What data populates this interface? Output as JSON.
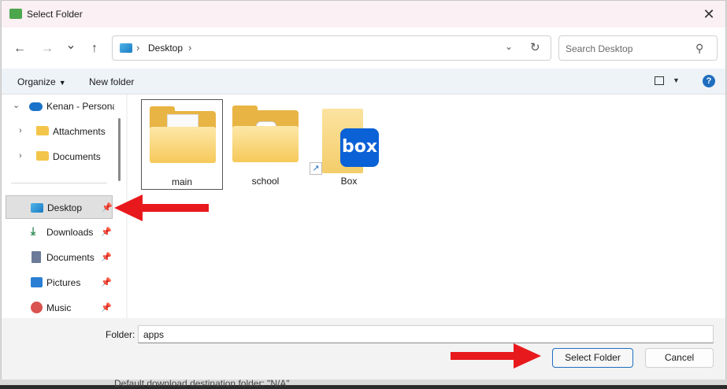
{
  "window": {
    "title": "Select Folder",
    "close_glyph": "✕"
  },
  "nav": {
    "back_glyph": "←",
    "forward_glyph": "→",
    "recent_glyph": "⌄",
    "up_glyph": "↑",
    "breadcrumb": [
      "Desktop"
    ],
    "search_placeholder": "Search Desktop"
  },
  "commands": {
    "organize": "Organize",
    "new_folder": "New folder",
    "help": "?"
  },
  "sidebar": {
    "items": [
      {
        "label": "Kenan - Persona",
        "icon": "cloud-icon"
      },
      {
        "label": "Attachments",
        "icon": "folder-icon"
      },
      {
        "label": "Documents",
        "icon": "folder-icon"
      },
      {
        "label": "Desktop",
        "icon": "desktop-icon",
        "selected": true
      },
      {
        "label": "Downloads",
        "icon": "download-icon"
      },
      {
        "label": "Documents",
        "icon": "document-icon"
      },
      {
        "label": "Pictures",
        "icon": "pictures-icon"
      },
      {
        "label": "Music",
        "icon": "music-icon"
      }
    ]
  },
  "content": {
    "items": [
      {
        "name": "main",
        "type": "folder",
        "selected": true
      },
      {
        "name": "school",
        "type": "folder"
      },
      {
        "name": "Box",
        "type": "shortcut",
        "logo_text": "box"
      }
    ]
  },
  "footer": {
    "folder_label": "Folder:",
    "folder_value": "apps",
    "select_button": "Select Folder",
    "cancel_button": "Cancel"
  },
  "background": {
    "text": "Default download destination folder: \"N/A\""
  },
  "colors": {
    "accent": "#1f6ebf",
    "annotation_arrow": "#e8191c",
    "folder": "#f3c54b",
    "box_brand": "#0b61d6"
  }
}
